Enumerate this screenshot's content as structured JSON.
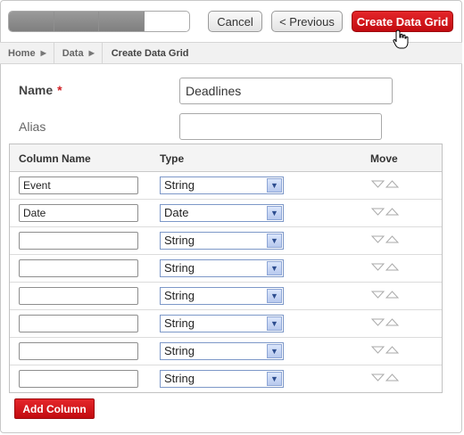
{
  "wizard": {
    "progress": {
      "total_steps": 4,
      "completed_steps": 3
    },
    "buttons": {
      "cancel_label": "Cancel",
      "previous_label": "< Previous",
      "create_label": "Create Data Grid"
    }
  },
  "breadcrumb": {
    "items": [
      {
        "label": "Home"
      },
      {
        "label": "Data"
      }
    ],
    "current": "Create Data Grid"
  },
  "form": {
    "name_label": "Name",
    "name_required_marker": "*",
    "name_value": "Deadlines",
    "alias_label": "Alias",
    "alias_value": ""
  },
  "grid": {
    "headers": {
      "column_name": "Column Name",
      "type": "Type",
      "move": "Move"
    },
    "rows": [
      {
        "column_name": "Event",
        "type": "String"
      },
      {
        "column_name": "Date",
        "type": "Date"
      },
      {
        "column_name": "",
        "type": "String"
      },
      {
        "column_name": "",
        "type": "String"
      },
      {
        "column_name": "",
        "type": "String"
      },
      {
        "column_name": "",
        "type": "String"
      },
      {
        "column_name": "",
        "type": "String"
      },
      {
        "column_name": "",
        "type": "String"
      }
    ]
  },
  "add_column_label": "Add Column",
  "colors": {
    "accent_red": "#d01f25",
    "select_border": "#7d98c8"
  }
}
